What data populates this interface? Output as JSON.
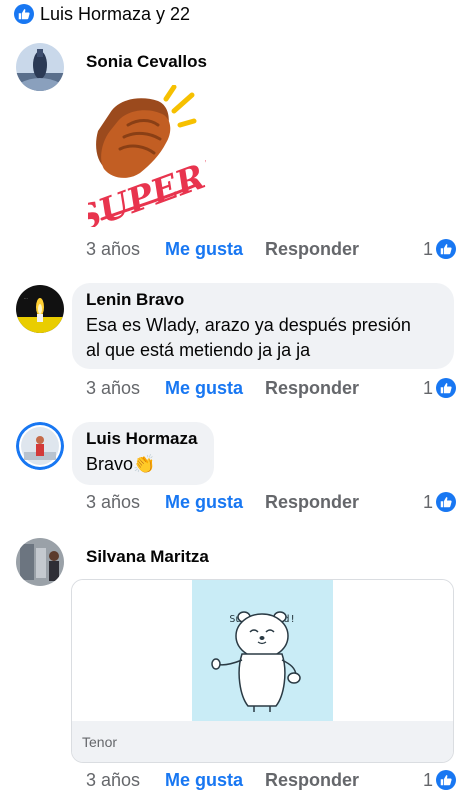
{
  "reactions_summary": {
    "label": "Luis Hormaza y 22"
  },
  "comments": [
    {
      "author": "Sonia Cevallos",
      "sticker_text": "SUPER!",
      "time": "3 años",
      "like_label": "Me gusta",
      "reply_label": "Responder",
      "like_count": "1"
    },
    {
      "author": "Lenin Bravo",
      "line1": "Esa es Wlady, arazo ya después presión",
      "line2": "al que está metiendo ja ja ja",
      "time": "3 años",
      "like_label": "Me gusta",
      "reply_label": "Responder",
      "like_count": "1"
    },
    {
      "author": "Luis Hormaza",
      "text": "Bravo",
      "emoji": "👏",
      "time": "3 años",
      "like_label": "Me gusta",
      "reply_label": "Responder",
      "like_count": "1"
    },
    {
      "author": "Silvana Maritza",
      "gif_caption": "Super good!",
      "gif_provider": "Tenor",
      "time": "3 años",
      "like_label": "Me gusta",
      "reply_label": "Responder",
      "like_count": "1"
    }
  ],
  "colors": {
    "brand_blue": "#1877f2",
    "muted_text": "#65676b",
    "bubble_bg": "#f0f2f5",
    "sticker_red": "#e8344e"
  }
}
